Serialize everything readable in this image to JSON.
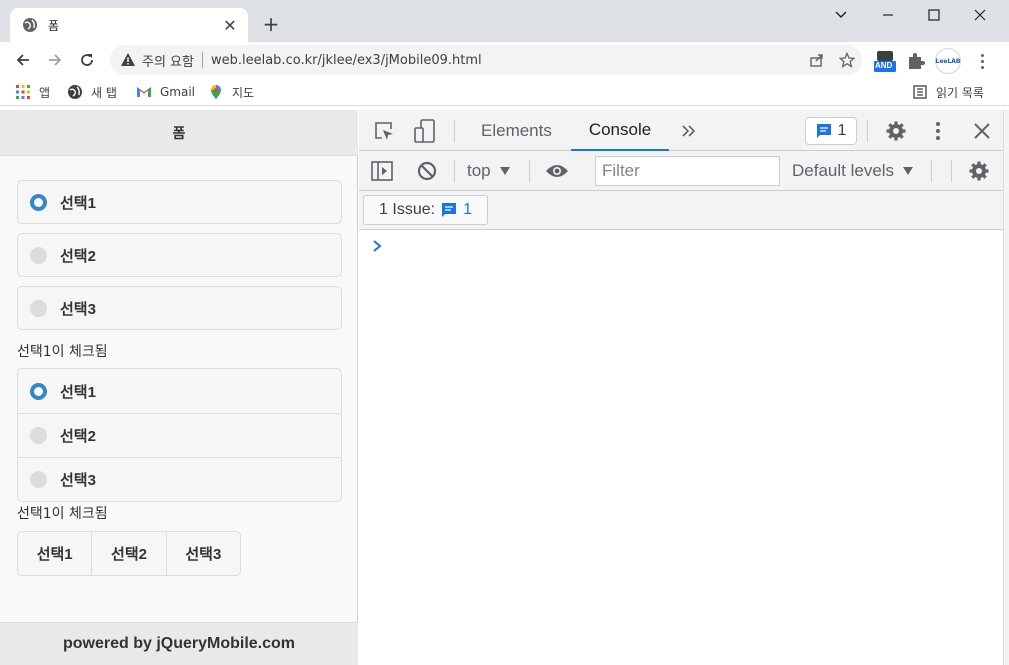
{
  "browser": {
    "tab_title": "폼",
    "new_tab_symbol": "+",
    "close_tab_symbol": "✕",
    "security_label": "주의 요함",
    "url": "web.leelab.co.kr/jklee/ex3/jMobile09.html",
    "extension_and_label": "AND",
    "extension_leelab_label": "LeeLAB"
  },
  "bookmarks": {
    "apps_label": "앱",
    "new_tab_label": "새 탭",
    "gmail_label": "Gmail",
    "maps_label": "지도",
    "reading_list_label": "읽기 목록"
  },
  "page": {
    "header_title": "폼",
    "radio_group_1": [
      {
        "label": "선택1",
        "checked": true
      },
      {
        "label": "선택2",
        "checked": false
      },
      {
        "label": "선택3",
        "checked": false
      }
    ],
    "status_1": "선택1이 체크됨",
    "radio_group_2": [
      {
        "label": "선택1",
        "checked": true
      },
      {
        "label": "선택2",
        "checked": false
      },
      {
        "label": "선택3",
        "checked": false
      }
    ],
    "status_2": "선택1이 체크됨",
    "radio_group_3": [
      {
        "label": "선택1"
      },
      {
        "label": "선택2"
      },
      {
        "label": "선택3"
      }
    ],
    "footer_text": "powered by jQueryMobile.com"
  },
  "devtools": {
    "tabs": [
      "Elements",
      "Console"
    ],
    "active_tab": "Console",
    "issues_count": "1",
    "context": "top",
    "filter_placeholder": "Filter",
    "levels_label": "Default levels",
    "issue_chip_label": "1 Issue:",
    "issue_chip_count": "1",
    "prompt_symbol": "›"
  },
  "colors": {
    "accent": "#1a73e8",
    "radio_on": "#3388cc"
  }
}
